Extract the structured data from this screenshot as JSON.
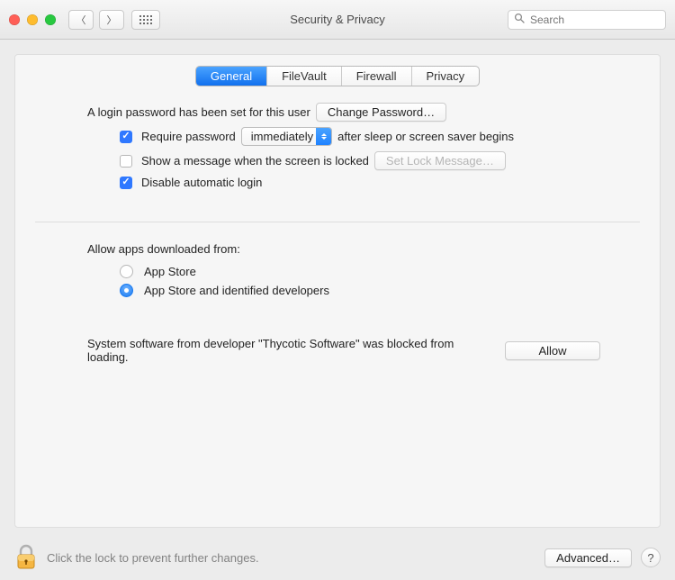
{
  "titlebar": {
    "title": "Security & Privacy",
    "search_placeholder": "Search"
  },
  "tabs": [
    "General",
    "FileVault",
    "Firewall",
    "Privacy"
  ],
  "selected_tab": 0,
  "login": {
    "set_text": "A login password has been set for this user",
    "change_button": "Change Password…",
    "require_label": "Require password",
    "require_checked": true,
    "delay_value": "immediately",
    "after_text": "after sleep or screen saver begins",
    "show_message_label": "Show a message when the screen is locked",
    "show_message_checked": false,
    "set_lock_button": "Set Lock Message…",
    "disable_auto_label": "Disable automatic login",
    "disable_auto_checked": true
  },
  "allow": {
    "header": "Allow apps downloaded from:",
    "options": [
      "App Store",
      "App Store and identified developers"
    ],
    "selected": 1,
    "block_text": "System software from developer \"Thycotic Software\" was blocked from loading.",
    "allow_button": "Allow"
  },
  "footer": {
    "lock_text": "Click the lock to prevent further changes.",
    "advanced_button": "Advanced…",
    "help": "?"
  }
}
